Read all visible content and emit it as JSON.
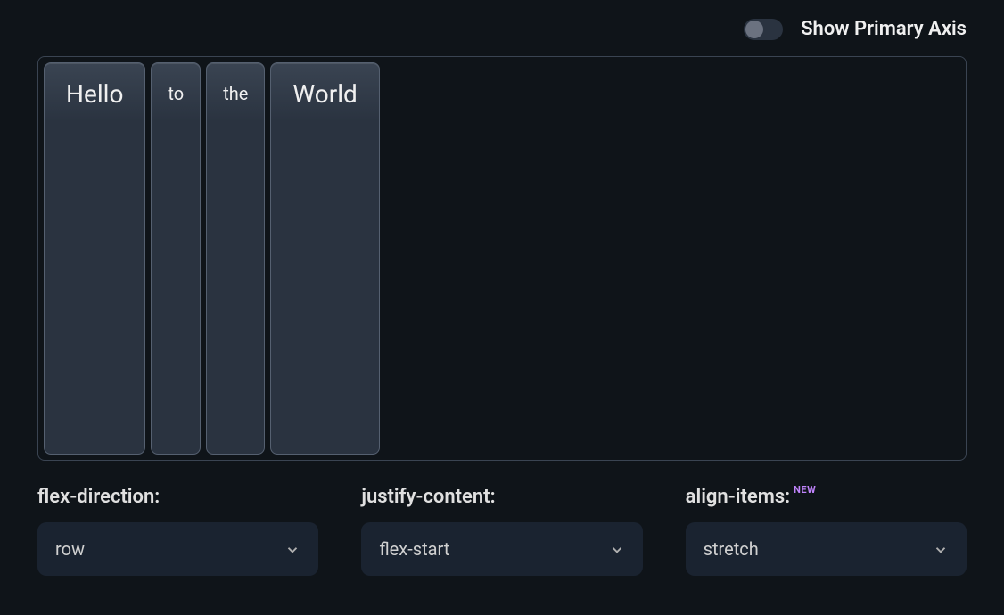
{
  "header": {
    "toggle_label": "Show Primary Axis",
    "toggle_state": false
  },
  "flex_items": [
    {
      "text": "Hello",
      "size": "large"
    },
    {
      "text": "to",
      "size": "small"
    },
    {
      "text": "the",
      "size": "small"
    },
    {
      "text": "World",
      "size": "large"
    }
  ],
  "controls": {
    "flex_direction": {
      "label": "flex-direction:",
      "value": "row"
    },
    "justify_content": {
      "label": "justify-content:",
      "value": "flex-start"
    },
    "align_items": {
      "label": "align-items:",
      "badge": "NEW",
      "value": "stretch"
    }
  }
}
